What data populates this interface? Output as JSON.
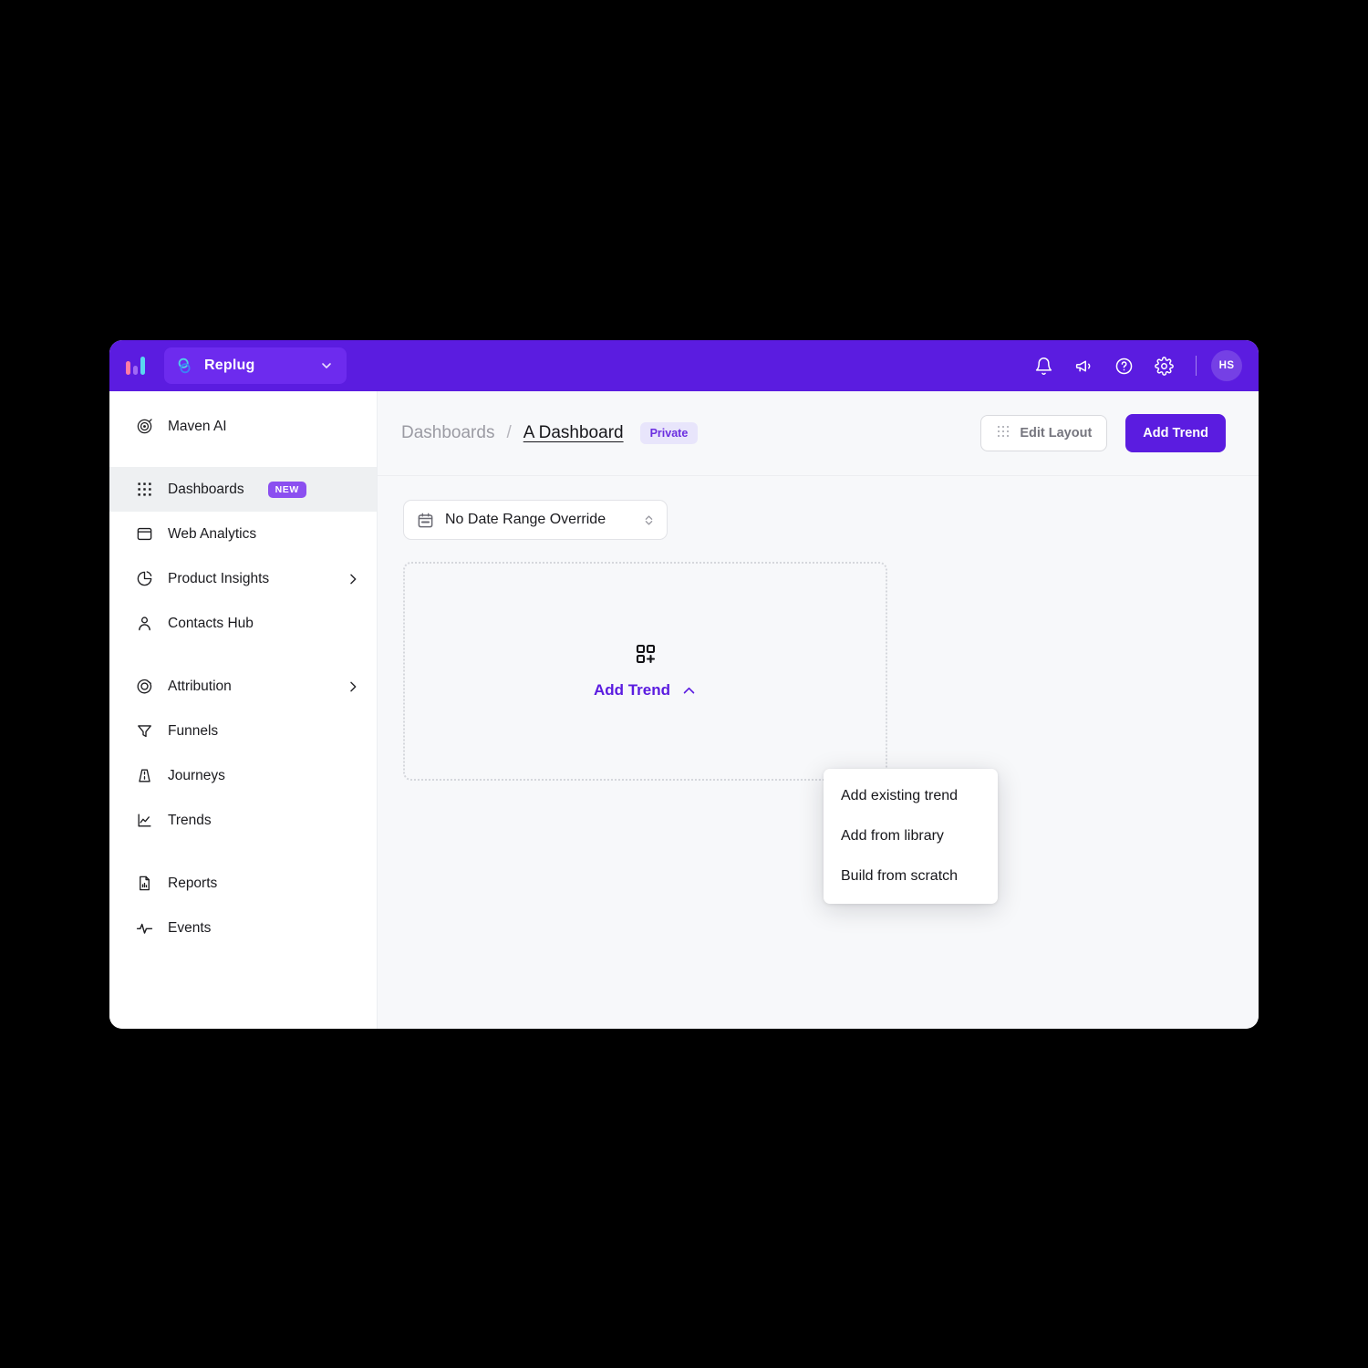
{
  "topbar": {
    "logo_icon": "bar-chart-logo-icon",
    "workspace": {
      "icon": "replug-logo-icon",
      "name": "Replug",
      "caret_icon": "chevron-down-icon"
    },
    "actions": [
      {
        "icon": "bell-icon",
        "name": "notifications"
      },
      {
        "icon": "megaphone-icon",
        "name": "announcements"
      },
      {
        "icon": "question-circle-icon",
        "name": "help"
      },
      {
        "icon": "gear-icon",
        "name": "settings"
      }
    ],
    "avatar_initials": "HS"
  },
  "sidebar": {
    "items": [
      {
        "label": "Maven AI",
        "icon": "maven-ai-icon",
        "badge": null,
        "chevron": false,
        "active": false,
        "gap_after": true
      },
      {
        "label": "Dashboards",
        "icon": "grid-dots-icon",
        "badge": "NEW",
        "chevron": false,
        "active": true,
        "gap_after": false
      },
      {
        "label": "Web Analytics",
        "icon": "browser-window-icon",
        "badge": null,
        "chevron": false,
        "active": false,
        "gap_after": false
      },
      {
        "label": "Product Insights",
        "icon": "pie-chart-icon",
        "badge": null,
        "chevron": true,
        "active": false,
        "gap_after": false
      },
      {
        "label": "Contacts Hub",
        "icon": "person-icon",
        "badge": null,
        "chevron": false,
        "active": false,
        "gap_after": true
      },
      {
        "label": "Attribution",
        "icon": "target-icon",
        "badge": null,
        "chevron": true,
        "active": false,
        "gap_after": false
      },
      {
        "label": "Funnels",
        "icon": "funnel-icon",
        "badge": null,
        "chevron": false,
        "active": false,
        "gap_after": false
      },
      {
        "label": "Journeys",
        "icon": "road-icon",
        "badge": null,
        "chevron": false,
        "active": false,
        "gap_after": false
      },
      {
        "label": "Trends",
        "icon": "line-chart-icon",
        "badge": null,
        "chevron": false,
        "active": false,
        "gap_after": true
      },
      {
        "label": "Reports",
        "icon": "report-document-icon",
        "badge": null,
        "chevron": false,
        "active": false,
        "gap_after": false
      },
      {
        "label": "Events",
        "icon": "activity-pulse-icon",
        "badge": null,
        "chevron": false,
        "active": false,
        "gap_after": false
      }
    ]
  },
  "page_header": {
    "breadcrumb_root": "Dashboards",
    "breadcrumb_separator": "/",
    "breadcrumb_current": "A Dashboard",
    "visibility_badge": "Private",
    "edit_layout_label": "Edit Layout",
    "edit_layout_icon": "grid-dots-icon",
    "add_trend_label": "Add Trend"
  },
  "content": {
    "date_range": {
      "icon": "calendar-icon",
      "value": "No Date Range Override",
      "caret_icon": "chevron-updown-icon"
    },
    "empty_state": {
      "icon": "add-widget-icon",
      "action_label": "Add Trend",
      "caret_icon": "chevron-up-icon"
    },
    "add_trend_menu": [
      {
        "label": "Add existing trend"
      },
      {
        "label": "Add from library"
      },
      {
        "label": "Build from scratch"
      }
    ]
  },
  "colors": {
    "brand_purple": "#5b1ce0",
    "accent_purple": "#8b4ff0",
    "badge_bg": "#e8e5fb",
    "badge_text": "#6b2fe0",
    "page_bg": "#f7f8fa",
    "sidebar_active": "#eef0f2"
  }
}
